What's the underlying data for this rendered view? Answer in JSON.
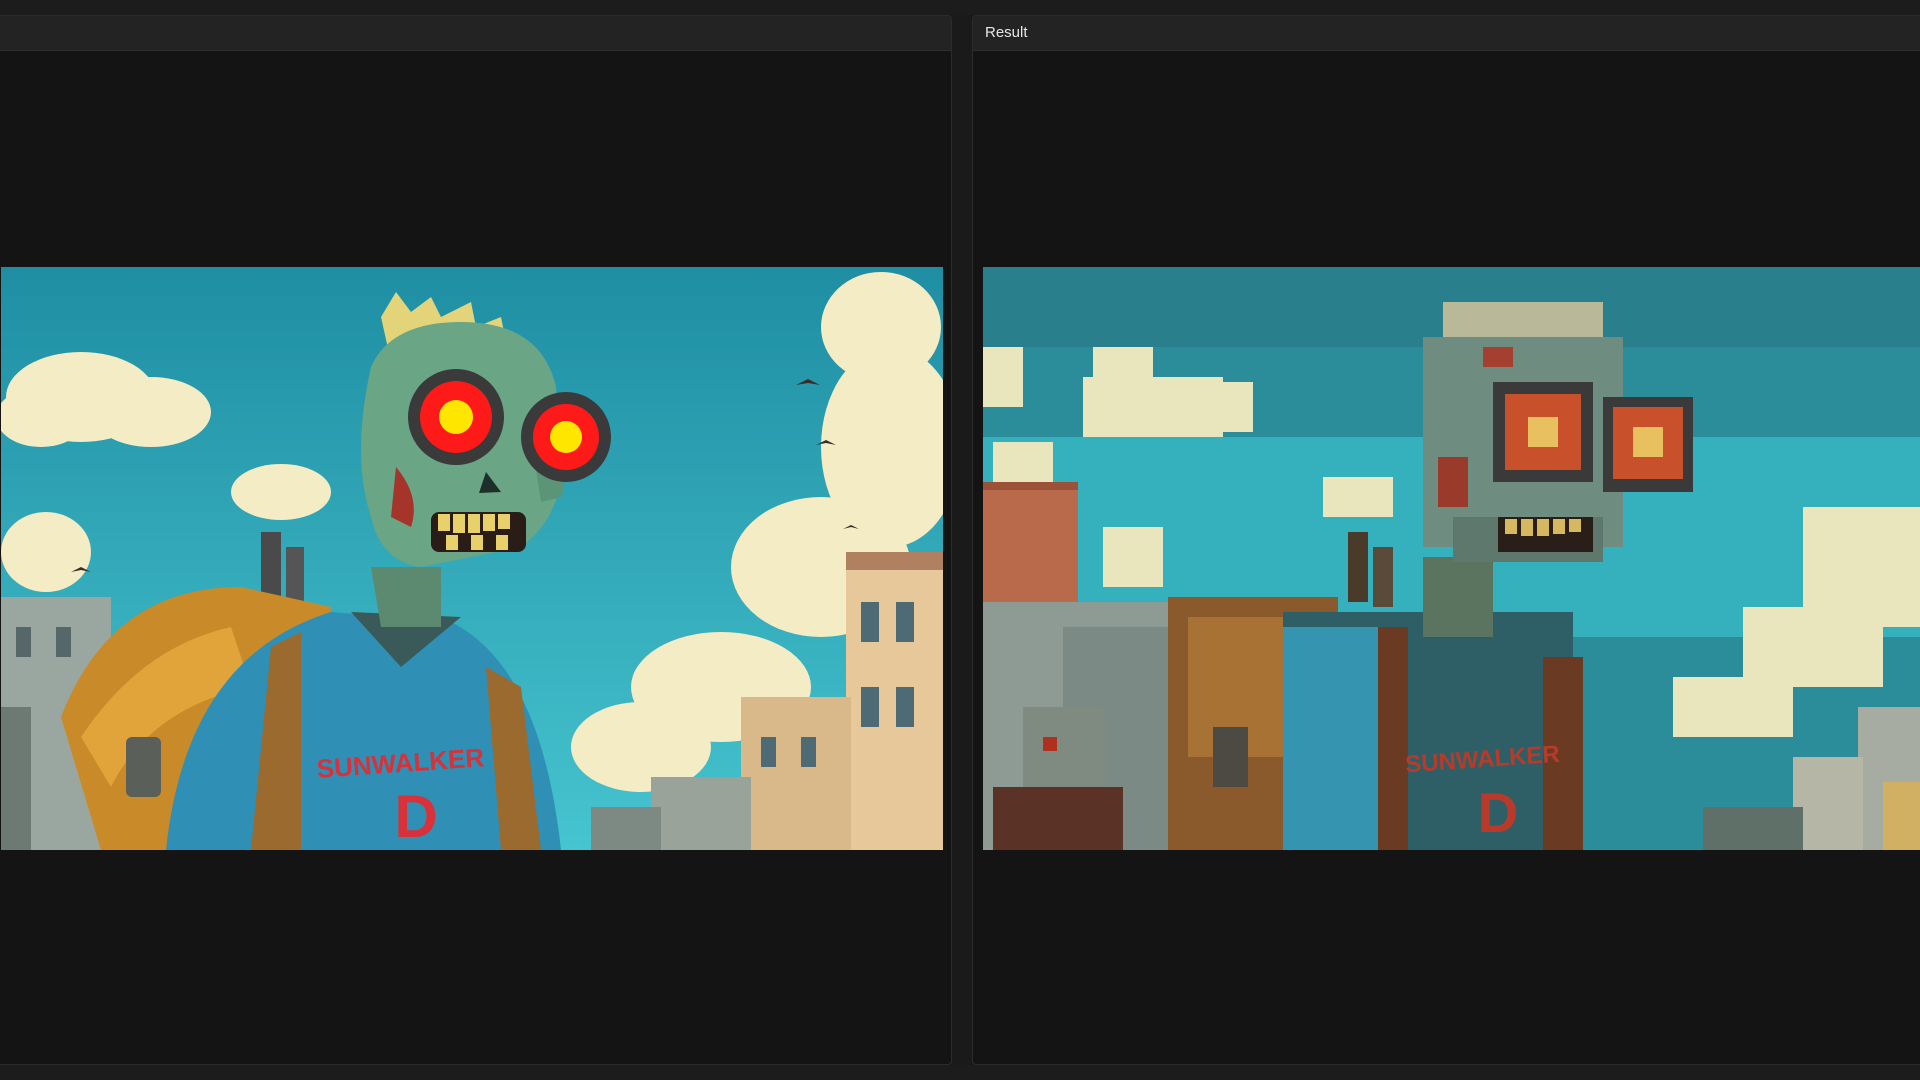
{
  "panels": {
    "left": {
      "title": "",
      "image": {
        "subject": "zombie-illustration",
        "shirt_text": "SUNWALKER",
        "shirt_logo": "D",
        "sky_color": "#2a9fb0",
        "eye_color": "#ff1a1a",
        "pupil_color": "#ffe600"
      }
    },
    "right": {
      "title": "Result",
      "image": {
        "subject": "zombie-illustration-pixelated",
        "shirt_text": "SUNWALKER",
        "shirt_logo": "D",
        "sky_color": "#2b8c9a",
        "eye_color": "#c8502a",
        "pupil_color": "#e8c060"
      }
    }
  }
}
